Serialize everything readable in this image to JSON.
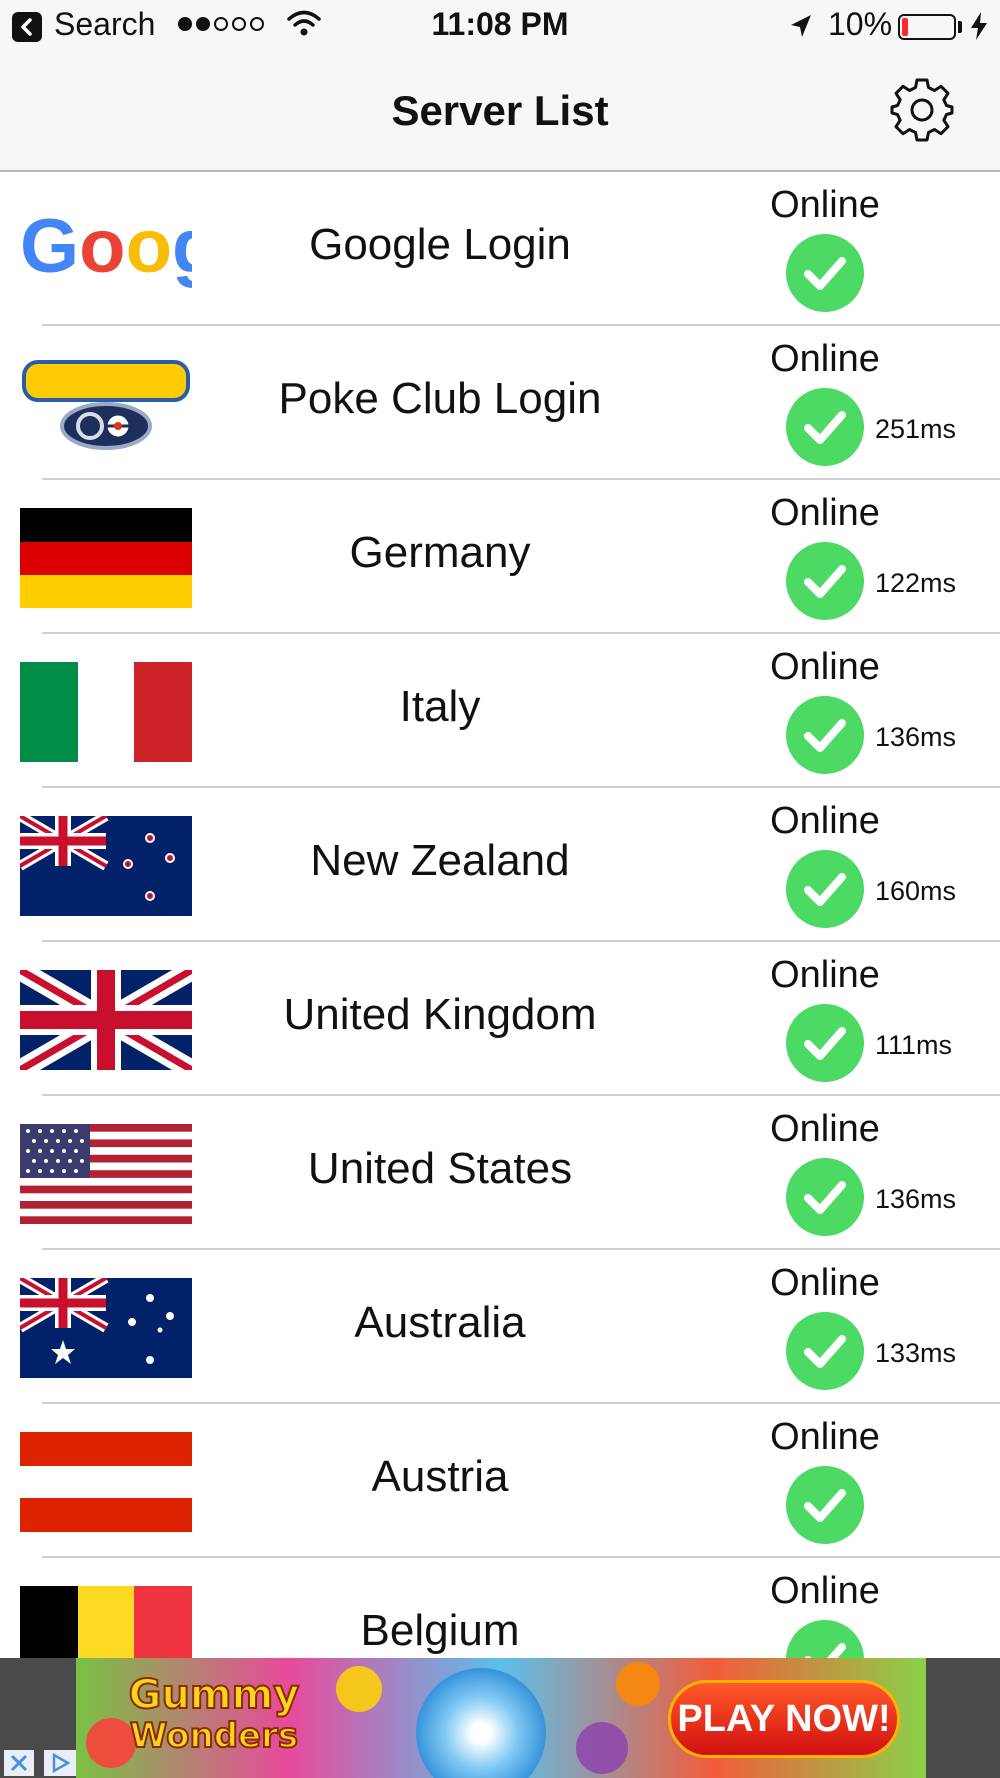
{
  "status_bar": {
    "back_label": "Search",
    "time": "11:08 PM",
    "battery": "10%",
    "battery_level": 0.1,
    "signal_bars": 2,
    "signal_total": 5
  },
  "nav": {
    "title": "Server List",
    "settings_icon": "gear-icon"
  },
  "servers": [
    {
      "name": "Google Login",
      "status": "Online",
      "ping": "",
      "logo": "google"
    },
    {
      "name": "Poke Club Login",
      "status": "Online",
      "ping": "251ms",
      "logo": "pokemon-go"
    },
    {
      "name": "Germany",
      "status": "Online",
      "ping": "122ms",
      "logo": "flag-germany"
    },
    {
      "name": "Italy",
      "status": "Online",
      "ping": "136ms",
      "logo": "flag-italy"
    },
    {
      "name": "New Zealand",
      "status": "Online",
      "ping": "160ms",
      "logo": "flag-new-zealand"
    },
    {
      "name": "United Kingdom",
      "status": "Online",
      "ping": "111ms",
      "logo": "flag-united-kingdom"
    },
    {
      "name": "United States",
      "status": "Online",
      "ping": "136ms",
      "logo": "flag-united-states"
    },
    {
      "name": "Australia",
      "status": "Online",
      "ping": "133ms",
      "logo": "flag-australia"
    },
    {
      "name": "Austria",
      "status": "Online",
      "ping": "",
      "logo": "flag-austria"
    },
    {
      "name": "Belgium",
      "status": "Online",
      "ping": "",
      "logo": "flag-belgium"
    }
  ],
  "ad": {
    "logo_top": "Gummy",
    "logo_bottom": "Wonders",
    "cta": "PLAY NOW!"
  },
  "colors": {
    "online_green": "#4cd964",
    "bar_bg": "#f7f7f7",
    "divider": "#d0d0d0",
    "battery_red": "#ff2a2a"
  }
}
